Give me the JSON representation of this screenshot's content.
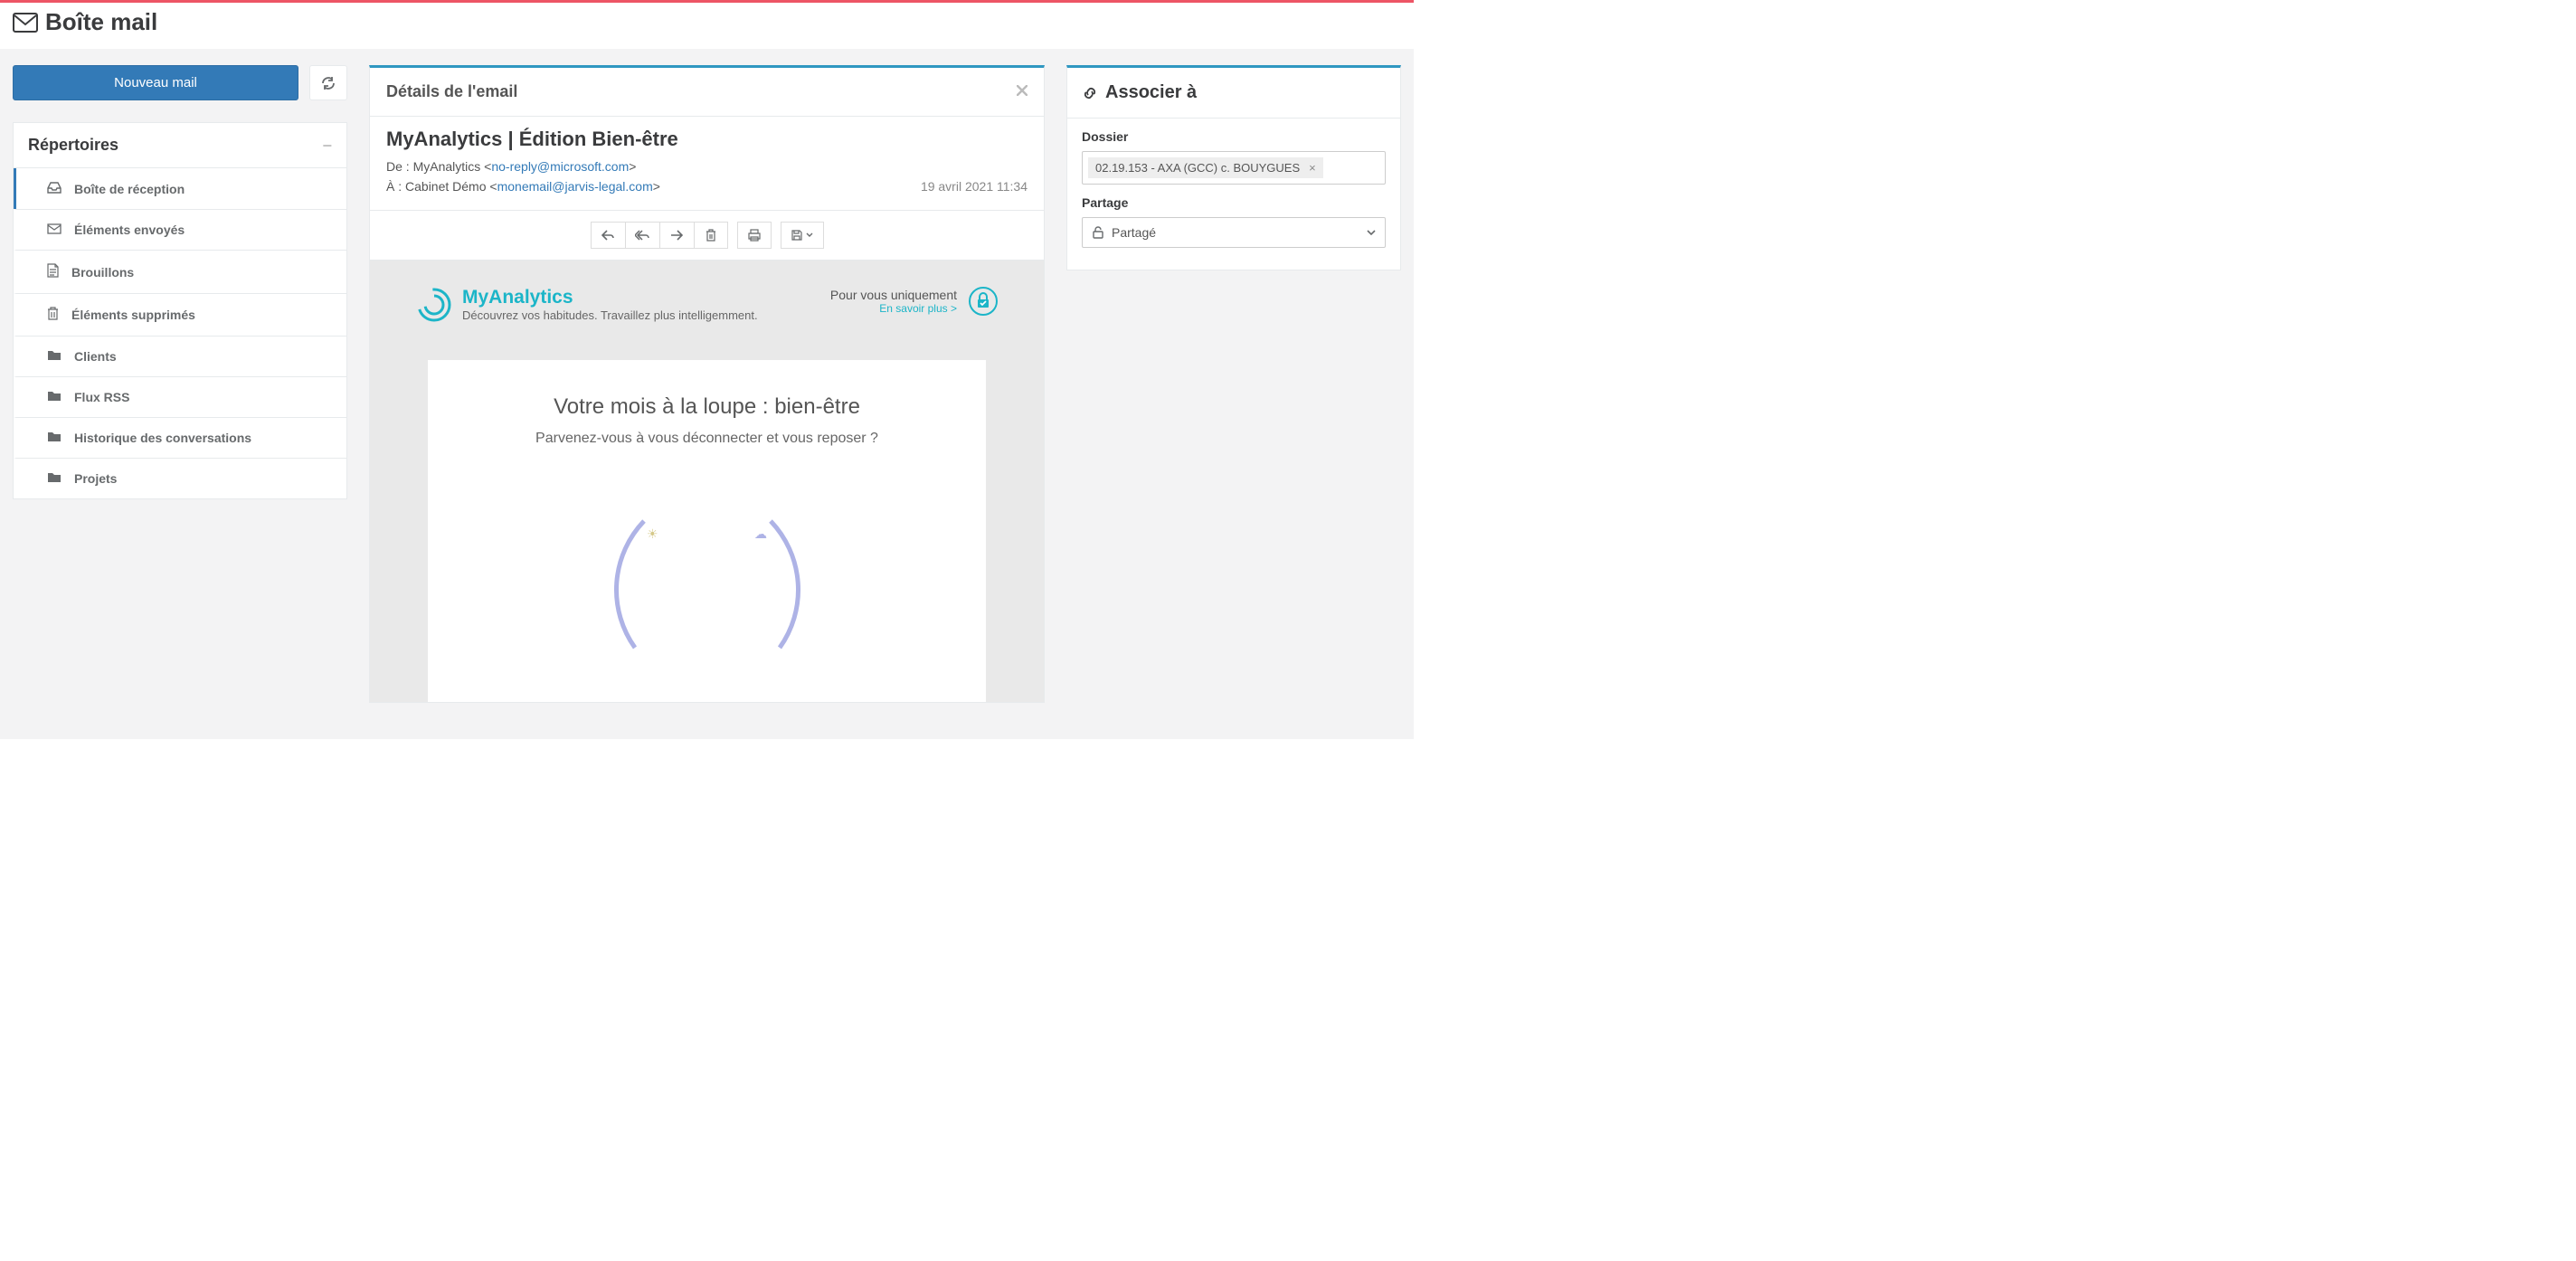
{
  "page": {
    "title": "Boîte mail"
  },
  "sidebar": {
    "compose_label": "Nouveau mail",
    "panel_title": "Répertoires",
    "items": [
      {
        "label": "Boîte de réception",
        "icon": "inbox-icon",
        "active": true
      },
      {
        "label": "Éléments envoyés",
        "icon": "sent-icon",
        "active": false
      },
      {
        "label": "Brouillons",
        "icon": "draft-icon",
        "active": false
      },
      {
        "label": "Éléments supprimés",
        "icon": "trash-icon",
        "active": false
      },
      {
        "label": "Clients",
        "icon": "folder-icon",
        "active": false
      },
      {
        "label": "Flux RSS",
        "icon": "folder-icon",
        "active": false
      },
      {
        "label": "Historique des conversations",
        "icon": "folder-icon",
        "active": false
      },
      {
        "label": "Projets",
        "icon": "folder-icon",
        "active": false
      }
    ]
  },
  "email": {
    "panel_title": "Détails de l'email",
    "subject": "MyAnalytics | Édition Bien-être",
    "from_label": "De :",
    "from_name": "MyAnalytics",
    "from_email": "no-reply@microsoft.com",
    "to_label": "À :",
    "to_name": "Cabinet Démo",
    "to_email": "monemail@jarvis-legal.com",
    "date": "19 avril 2021 11:34",
    "body": {
      "brand_name": "MyAnalytics",
      "brand_tagline": "Découvrez vos habitudes. Travaillez plus intelligemment.",
      "for_you": "Pour vous uniquement",
      "learn_more": "En savoir plus >",
      "card_title": "Votre mois à la loupe : bien-être",
      "card_sub": "Parvenez-vous à vous déconnecter et vous reposer ?"
    }
  },
  "associate": {
    "panel_title": "Associer à",
    "dossier_label": "Dossier",
    "dossier_value": "02.19.153 - AXA (GCC) c. BOUYGUES",
    "share_label": "Partage",
    "share_value": "Partagé"
  }
}
